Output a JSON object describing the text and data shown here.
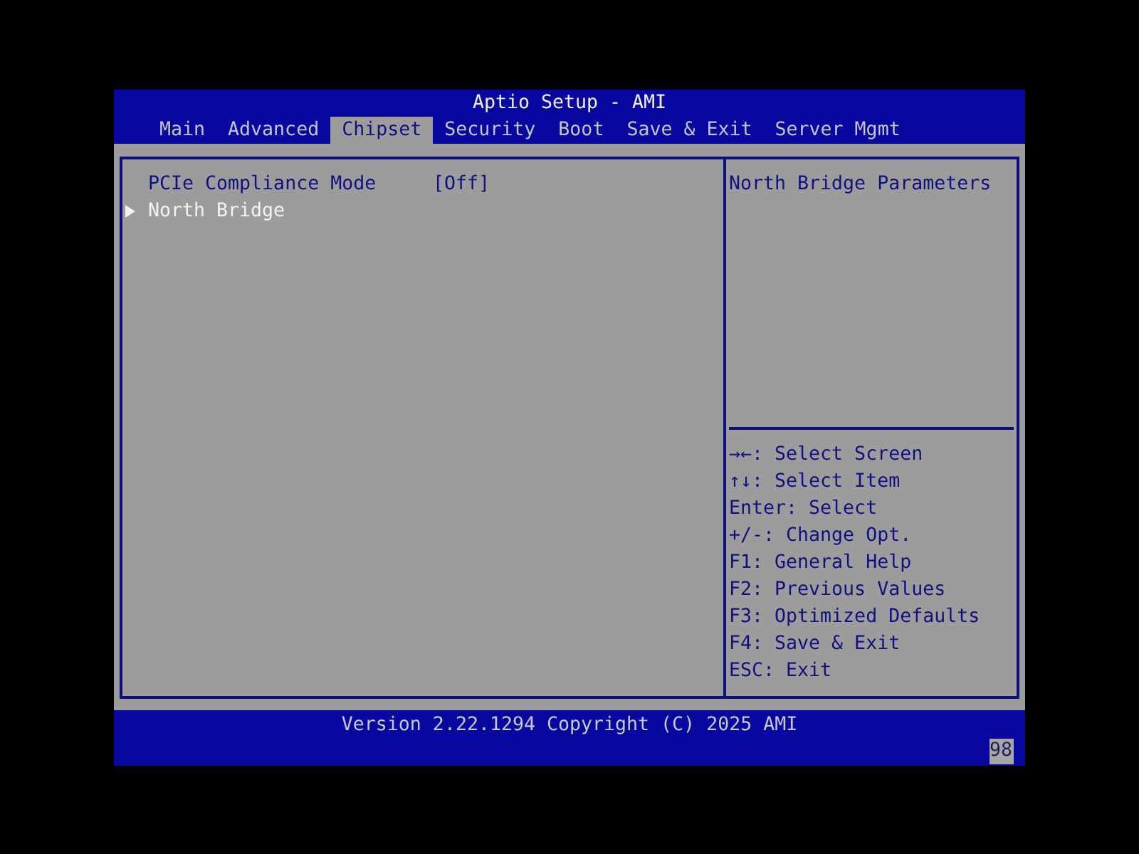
{
  "window": {
    "title": "Aptio Setup - AMI"
  },
  "tabs": [
    {
      "label": "Main",
      "selected": false
    },
    {
      "label": "Advanced",
      "selected": false
    },
    {
      "label": "Chipset",
      "selected": true
    },
    {
      "label": "Security",
      "selected": false
    },
    {
      "label": "Boot",
      "selected": false
    },
    {
      "label": "Save & Exit",
      "selected": false
    },
    {
      "label": "Server Mgmt",
      "selected": false
    }
  ],
  "settings": [
    {
      "kind": "option",
      "label": "PCIe Compliance Mode",
      "value": "[Off]",
      "selected": false
    },
    {
      "kind": "submenu",
      "label": "North Bridge",
      "selected": true
    }
  ],
  "help_text": "North Bridge Parameters",
  "key_help": [
    "→←: Select Screen",
    "↑↓: Select Item",
    "Enter: Select",
    "+/-: Change Opt.",
    "F1: General Help",
    "F2: Previous Values",
    "F3: Optimized Defaults",
    "F4: Save & Exit",
    "ESC: Exit"
  ],
  "status_bar": {
    "version": "Version 2.22.1294 Copyright (C) 2025 AMI",
    "code": "98"
  }
}
